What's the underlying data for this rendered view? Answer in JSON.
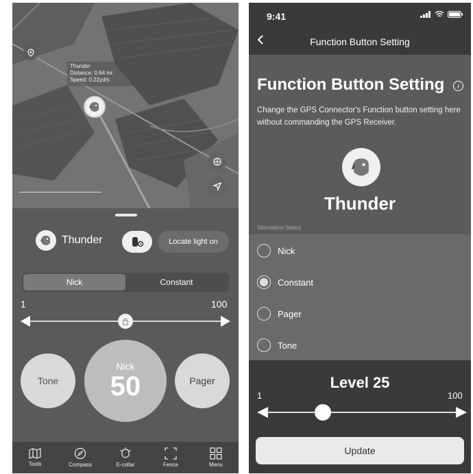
{
  "left": {
    "map": {
      "info": {
        "name": "Thunder",
        "distance": "Distance: 0.64 mi",
        "speed": "Speed: 0.22yd/s"
      }
    },
    "dog_name": "Thunder",
    "locate_label": "Locate light on",
    "modes": {
      "nick": "Nick",
      "constant": "Constant",
      "selected": "Nick"
    },
    "range": {
      "min": "1",
      "max": "100"
    },
    "slider_value": 50,
    "buttons": {
      "tone": "Tone",
      "nick_label": "Nick",
      "nick_value": "50",
      "pager": "Pager"
    },
    "tabs": [
      {
        "label": "Tools",
        "icon": "map-icon"
      },
      {
        "label": "Compass",
        "icon": "compass-icon"
      },
      {
        "label": "E-collar",
        "icon": "e-collar-icon"
      },
      {
        "label": "Fence",
        "icon": "fence-icon"
      },
      {
        "label": "Menu",
        "icon": "grid-icon"
      }
    ]
  },
  "right": {
    "status": {
      "time": "9:41"
    },
    "nav_title": "Function Button Setting",
    "page_title": "Function Button Setting",
    "description": "Change the GPS Connector's Function button setting here without commanding the GPS Receiver.",
    "dog_name": "Thunder",
    "section_label": "Stimulation Select",
    "options": [
      "Nick",
      "Constant",
      "Pager",
      "Tone"
    ],
    "selected_option": "Constant",
    "level_title": "Level 25",
    "range": {
      "min": "1",
      "max": "100"
    },
    "level_value": 25,
    "update_label": "Update"
  }
}
